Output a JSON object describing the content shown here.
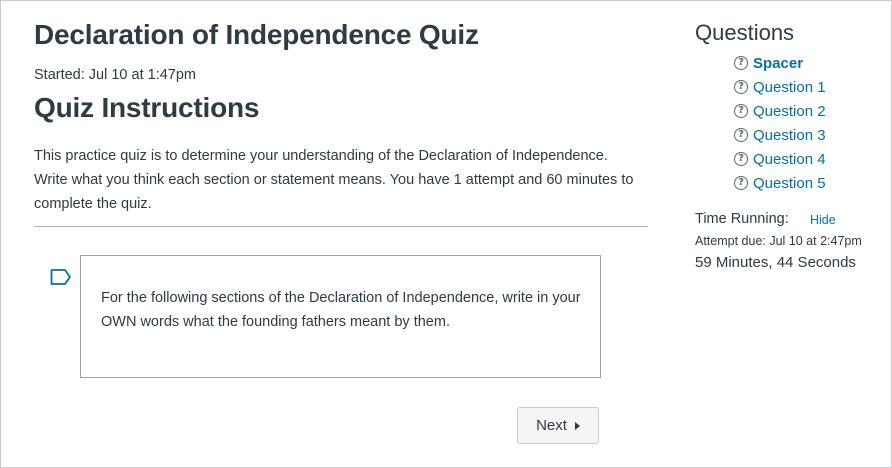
{
  "quiz": {
    "title": "Declaration of Independence Quiz",
    "started": "Started: Jul 10 at 1:47pm",
    "instructions_heading": "Quiz Instructions",
    "instructions": "This practice quiz is to determine your understanding of the Declaration of Independence. Write what you think each section or statement means. You have 1 attempt and 60 minutes to complete the quiz."
  },
  "question": {
    "text": "For the following sections of the Declaration of Independence, write in your OWN words what the founding fathers meant by them.",
    "flag_icon": "flag-outline-icon"
  },
  "navigation": {
    "next_label": "Next",
    "next_icon": "caret-right-icon"
  },
  "sidebar": {
    "title": "Questions",
    "items": [
      {
        "label": "Spacer",
        "icon": "question-circle-icon",
        "current": true
      },
      {
        "label": "Question 1",
        "icon": "question-circle-icon",
        "current": false
      },
      {
        "label": "Question 2",
        "icon": "question-circle-icon",
        "current": false
      },
      {
        "label": "Question 3",
        "icon": "question-circle-icon",
        "current": false
      },
      {
        "label": "Question 4",
        "icon": "question-circle-icon",
        "current": false
      },
      {
        "label": "Question 5",
        "icon": "question-circle-icon",
        "current": false
      }
    ],
    "timer": {
      "label": "Time Running:",
      "hide_label": "Hide",
      "attempt_due": "Attempt due: Jul 10 at 2:47pm",
      "remaining": "59 Minutes, 44 Seconds"
    }
  },
  "colors": {
    "text": "#2d3b45",
    "link": "#0770a3",
    "border": "#c7cdd1",
    "button_bg": "#f5f5f5"
  }
}
